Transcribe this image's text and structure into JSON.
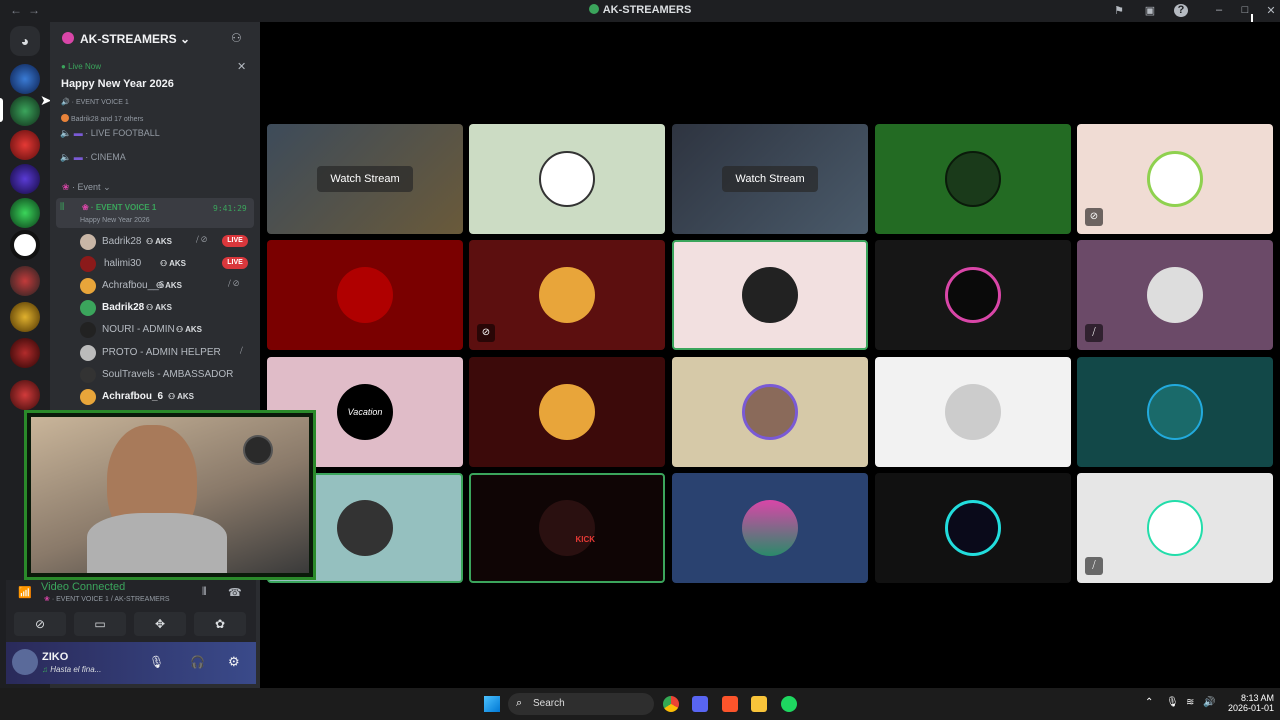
{
  "window": {
    "title": "AK-STREAMERS",
    "back": "←",
    "fwd": "→"
  },
  "server": {
    "name": "AK-STREAMERS"
  },
  "event_banner": {
    "status": "Live Now",
    "title": "Happy New Year 2026",
    "channel": "EVENT VOICE 1",
    "attendees": "Badrik28 and 17 others"
  },
  "channels": {
    "live_football": "LIVE FOOTBALL",
    "cinema": "CINEMA",
    "category": "Event",
    "voice_name": "EVENT VOICE 1",
    "voice_timer": "9:41:29",
    "voice_topic": "Happy New Year 2026"
  },
  "members": [
    {
      "name": "Badrik28",
      "tag": "AKS",
      "live": "LIVE"
    },
    {
      "name": "halimi30",
      "tag": "AKS",
      "live": "LIVE"
    },
    {
      "name": "Achrafbou__6",
      "tag": "AKS"
    },
    {
      "name": "Badrik28",
      "tag": "AKS"
    },
    {
      "name": "NOURI - ADMIN",
      "tag": "AKS"
    },
    {
      "name": "PROTO - ADMIN HELPER",
      "tag": ""
    },
    {
      "name": "SoulTravels - AMBASSADOR",
      "tag": ""
    },
    {
      "name": "Achrafbou_6",
      "tag": "AKS"
    }
  ],
  "voice_status": {
    "title": "Video Connected",
    "location": "EVENT VOICE 1 / AK-STREAMERS"
  },
  "user": {
    "name": "ZIKO",
    "status": "Hasta el fina..."
  },
  "tiles": {
    "watch_label": "Watch Stream",
    "vacation_text": "Vacation",
    "kick_text": "KICK"
  },
  "taskbar": {
    "search": "Search",
    "time": "8:13 AM",
    "date": "2026-01-01"
  },
  "colors": {
    "accent_green": "#3ba55c",
    "live_red": "#da373c",
    "bg_dark": "#1e1f22",
    "panel": "#2b2d31"
  }
}
